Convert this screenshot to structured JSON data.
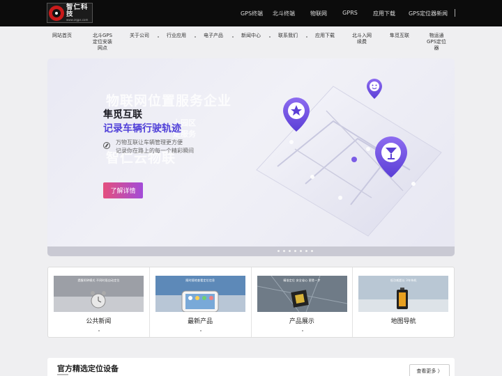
{
  "header": {
    "logo_text": "智仁科技",
    "logo_url": "www.zrgps.com",
    "nav": [
      {
        "label": "GPS终端"
      },
      {
        "label": "北斗终端"
      },
      {
        "label": "物联网"
      },
      {
        "label": "GPRS"
      },
      {
        "label": "应用下载"
      },
      {
        "label": "GPS定位器新闻"
      }
    ]
  },
  "subnav": [
    {
      "label": "网站首页"
    },
    {
      "label": "北斗GPS\n定位安装\n网点"
    },
    {
      "label": "关于公司"
    },
    {
      "label": "行业应用"
    },
    {
      "label": "电子产品"
    },
    {
      "label": "新闻中心"
    },
    {
      "label": "联系我们"
    },
    {
      "label": "应用下载"
    },
    {
      "label": "北斗入网\n续费"
    },
    {
      "label": "隼觅互联"
    },
    {
      "label": "物运通\nGPS定位\n器"
    }
  ],
  "banner": {
    "watermark_1": "物联网位置服务企业",
    "watermark_2": "智仁云物联",
    "watermark_3": "上园区",
    "watermark_4": "定服务",
    "title": "隼觅互联",
    "subtitle": "记录车辆行驶轨迹",
    "line_1": "万物互联让车辆管理更方便",
    "line_2": "记录你在路上的每一个精彩瞬间",
    "button_label": "了解详情",
    "accent_color": "#4f3fd8"
  },
  "cards": [
    {
      "label": "公共新闻",
      "caption": "提醒闹钟模式 不同时段自动定位",
      "icon": "alarm-clock-icon"
    },
    {
      "label": "最新产品",
      "caption": "随时随地查看定位信息",
      "icon": "phone-app-icon"
    },
    {
      "label": "产品展示",
      "caption": "精准定位 安全省心 更胜一步",
      "icon": "chip-icon"
    },
    {
      "label": "地图导航",
      "caption": "低功耗超长 3年待机",
      "icon": "battery-icon"
    }
  ],
  "section": {
    "title": "官方精选定位设备",
    "more_label": "查看更多 〉"
  }
}
